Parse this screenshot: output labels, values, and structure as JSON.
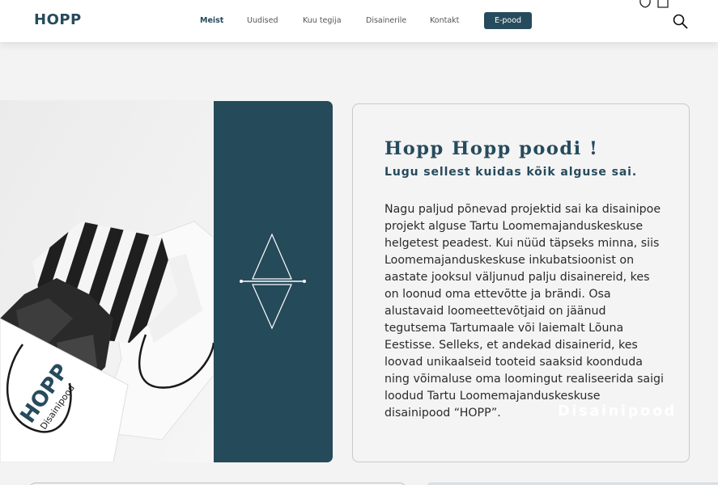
{
  "header": {
    "logo": "HOPP",
    "nav": [
      "Meist",
      "Uudised",
      "Kuu tegija",
      "Disainerile",
      "Kontakt"
    ],
    "active_nav": "Meist",
    "shop_button": "E-pood",
    "icons": [
      "heart-icon",
      "cart-icon",
      "search-icon"
    ]
  },
  "hero": {
    "bag_logo": "HOPP",
    "bag_caption": "Disainipood"
  },
  "intro": {
    "title": "Hopp Hopp poodi !",
    "subtitle": "Lugu sellest kuidas kõik alguse sai.",
    "body_lines": [
      "Nagu paljud põnevad projektid sai ka disainipoe",
      "projekt alguse Tartu Loomemajanduskeskuse",
      "helgetest peadest. Kui nüüd täpseks minna, siis",
      "Loomemajanduskeskuse inkubatsioonist on",
      "aastate jooksul väljunud palju disainereid, kes",
      "on loonud oma ettevõtte ja brändi. Osa",
      "alustavaid loomeettevõtjaid on jäänud",
      "tegutsema Tartumaale või laiemalt Lõuna",
      "Eestisse. Selleks, et andekad disainerid, kes",
      "loovad  unikaalseid tooteid saaksid koonduda",
      "ning võimaluse oma loomingut realiseerida saigi",
      "loodud Tartu Loomemajanduskeskuse",
      "disainipood “HOPP”."
    ],
    "watermark": "Disainipood"
  },
  "colors": {
    "brand": "#264b5d",
    "panel": "#254a5a",
    "background": "#f3f3f3"
  }
}
